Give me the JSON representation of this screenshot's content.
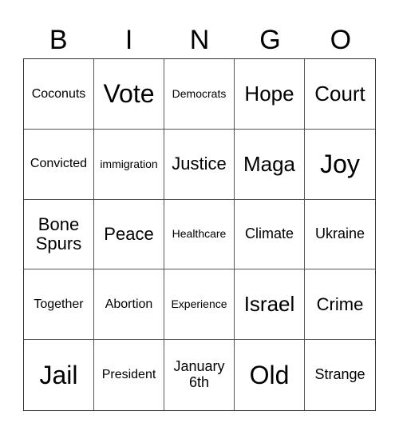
{
  "header": [
    "B",
    "I",
    "N",
    "G",
    "O"
  ],
  "cells": [
    "Coconuts",
    "Vote",
    "Democrats",
    "Hope",
    "Court",
    "Convicted",
    "immigration",
    "Justice",
    "Maga",
    "Joy",
    "Bone Spurs",
    "Peace",
    "Healthcare",
    "Climate",
    "Ukraine",
    "Together",
    "Abortion",
    "Experience",
    "Israel",
    "Crime",
    "Jail",
    "President",
    "January 6th",
    "Old",
    "Strange"
  ]
}
